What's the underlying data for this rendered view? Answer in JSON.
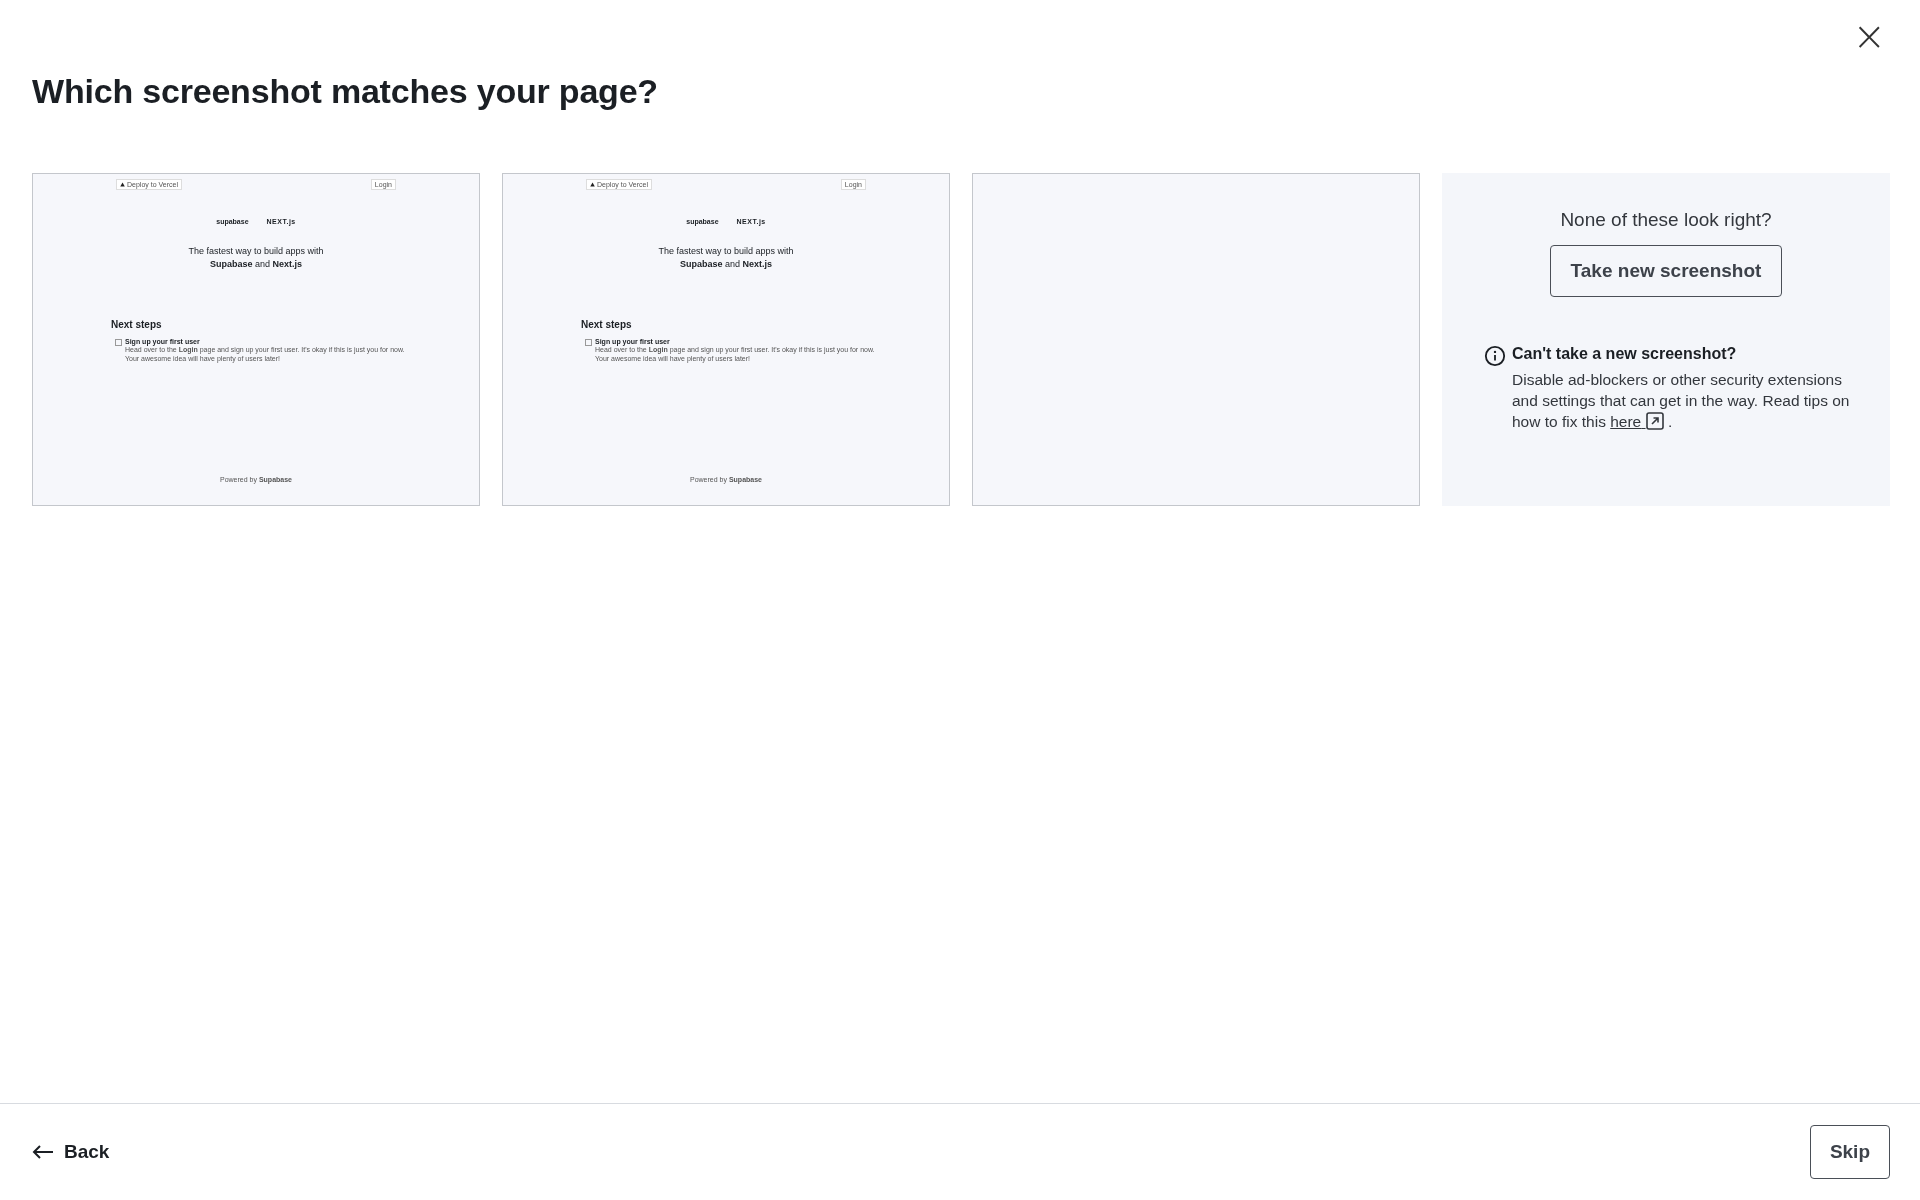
{
  "dialog": {
    "title": "Which screenshot matches your page?",
    "close": "×"
  },
  "screenshots": [
    {
      "kind": "page",
      "deploy": "Deploy to Vercel",
      "login": "Login",
      "logo_left": "supabase",
      "logo_right": "NEXT.js",
      "headline": "The fastest way to build apps with",
      "headline_2": "**Supabase** and **Next.js**",
      "steps_title": "Next steps",
      "checked": false,
      "step_title": "Sign up your first user",
      "step_text": "Head over to the **Login** page and sign up your first user. It's okay if this is just you for now. Your awesome idea will have plenty of users later!",
      "footer": "Powered by **Supabase**"
    },
    {
      "kind": "page",
      "deploy": "Deploy to Vercel",
      "login": "Login",
      "logo_left": "supabase",
      "logo_right": "NEXT.js",
      "headline": "The fastest way to build apps with",
      "headline_2": "**Supabase** and **Next.js**",
      "steps_title": "Next steps",
      "step_title": "Sign up your first user",
      "step_text": "Head over to the **Login** page and sign up your first user. It's okay if this is just you for now. Your awesome idea will have plenty of users later!",
      "footer": "Powered by **Supabase**",
      "checked": false
    },
    {
      "kind": "blank"
    }
  ],
  "help": {
    "question": "None of these look right?",
    "button": "Take new screenshot",
    "note_title": "Can't take a new screenshot?",
    "note_text": "Disable ad-blockers or other security extensions and settings that can get in the way. Read tips on how to fix this",
    "link": "here",
    "after_link": "."
  },
  "footer": {
    "back": "Back",
    "skip": "Skip"
  }
}
